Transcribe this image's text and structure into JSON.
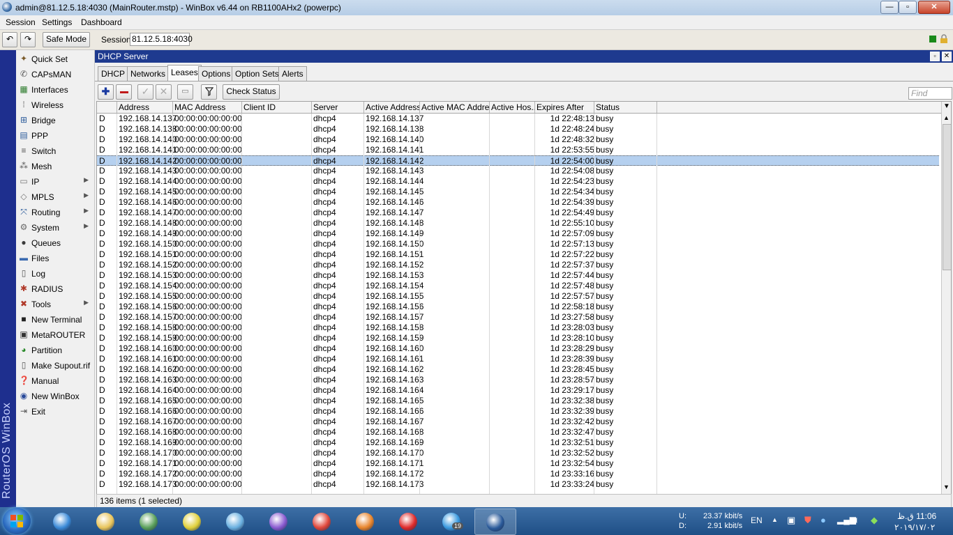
{
  "window": {
    "title": "admin@81.12.5.18:4030 (MainRouter.mstp) - WinBox v6.44 on RB1100AHx2 (powerpc)",
    "min": "—",
    "max": "▫",
    "close": "✕"
  },
  "menu": {
    "session": "Session",
    "settings": "Settings",
    "dashboard": "Dashboard"
  },
  "toolbar": {
    "undo": "↶",
    "redo": "↷",
    "safe_mode": "Safe Mode",
    "session_label": "Session:",
    "session_value": "81.12.5.18:4030"
  },
  "vbar_text": "RouterOS WinBox",
  "sidebar": [
    {
      "label": "Quick Set",
      "icon": "quick-set-icon",
      "glyph": "✦",
      "color": "#7a5a2a",
      "arrow": false
    },
    {
      "label": "CAPsMAN",
      "icon": "capsman-icon",
      "glyph": "✆",
      "color": "#555",
      "arrow": false
    },
    {
      "label": "Interfaces",
      "icon": "interfaces-icon",
      "glyph": "▦",
      "color": "#2a7a2a",
      "arrow": false
    },
    {
      "label": "Wireless",
      "icon": "wireless-icon",
      "glyph": "⁞",
      "color": "#555",
      "arrow": false
    },
    {
      "label": "Bridge",
      "icon": "bridge-icon",
      "glyph": "⊞",
      "color": "#2a5a9a",
      "arrow": false
    },
    {
      "label": "PPP",
      "icon": "ppp-icon",
      "glyph": "▤",
      "color": "#2a5a9a",
      "arrow": false
    },
    {
      "label": "Switch",
      "icon": "switch-icon",
      "glyph": "≡",
      "color": "#555",
      "arrow": false
    },
    {
      "label": "Mesh",
      "icon": "mesh-icon",
      "glyph": "⁂",
      "color": "#555",
      "arrow": false
    },
    {
      "label": "IP",
      "icon": "ip-icon",
      "glyph": "▭",
      "color": "#777",
      "arrow": true
    },
    {
      "label": "MPLS",
      "icon": "mpls-icon",
      "glyph": "◇",
      "color": "#777",
      "arrow": true
    },
    {
      "label": "Routing",
      "icon": "routing-icon",
      "glyph": "⤧",
      "color": "#2a5a9a",
      "arrow": true
    },
    {
      "label": "System",
      "icon": "system-icon",
      "glyph": "⚙",
      "color": "#666",
      "arrow": true
    },
    {
      "label": "Queues",
      "icon": "queues-icon",
      "glyph": "●",
      "color": "#3a3a3a",
      "arrow": false
    },
    {
      "label": "Files",
      "icon": "files-icon",
      "glyph": "▬",
      "color": "#3a6ab0",
      "arrow": false
    },
    {
      "label": "Log",
      "icon": "log-icon",
      "glyph": "▯",
      "color": "#555",
      "arrow": false
    },
    {
      "label": "RADIUS",
      "icon": "radius-icon",
      "glyph": "✱",
      "color": "#b03a2a",
      "arrow": false
    },
    {
      "label": "Tools",
      "icon": "tools-icon",
      "glyph": "✖",
      "color": "#b03a2a",
      "arrow": true
    },
    {
      "label": "New Terminal",
      "icon": "terminal-icon",
      "glyph": "■",
      "color": "#222",
      "arrow": false
    },
    {
      "label": "MetaROUTER",
      "icon": "metarouter-icon",
      "glyph": "▣",
      "color": "#333",
      "arrow": false
    },
    {
      "label": "Partition",
      "icon": "partition-icon",
      "glyph": "◕",
      "color": "#2a8a2a",
      "arrow": false
    },
    {
      "label": "Make Supout.rif",
      "icon": "supout-icon",
      "glyph": "▯",
      "color": "#555",
      "arrow": false
    },
    {
      "label": "Manual",
      "icon": "manual-icon",
      "glyph": "❓",
      "color": "#2a4a9a",
      "arrow": false
    },
    {
      "label": "New WinBox",
      "icon": "new-winbox-icon",
      "glyph": "◉",
      "color": "#2a4a9a",
      "arrow": false
    },
    {
      "label": "Exit",
      "icon": "exit-icon",
      "glyph": "⇥",
      "color": "#555",
      "arrow": false
    }
  ],
  "dhcp": {
    "title": "DHCP Server",
    "tabs": [
      "DHCP",
      "Networks",
      "Leases",
      "Options",
      "Option Sets",
      "Alerts"
    ],
    "active_tab": 2,
    "check_status": "Check Status",
    "find_placeholder": "Find",
    "columns": [
      "",
      "Address",
      "MAC Address",
      "Client ID",
      "Server",
      "Active Address",
      "Active MAC Addre...",
      "Active Hos...",
      "Expires After",
      "Status"
    ],
    "rows": [
      {
        "flag": "D",
        "address": "192.168.14.137",
        "mac": "00:00:00:00:00:00",
        "server": "dhcp4",
        "active_address": "192.168.14.137",
        "expires": "1d 22:48:13",
        "status": "busy"
      },
      {
        "flag": "D",
        "address": "192.168.14.138",
        "mac": "00:00:00:00:00:00",
        "server": "dhcp4",
        "active_address": "192.168.14.138",
        "expires": "1d 22:48:24",
        "status": "busy"
      },
      {
        "flag": "D",
        "address": "192.168.14.140",
        "mac": "00:00:00:00:00:00",
        "server": "dhcp4",
        "active_address": "192.168.14.140",
        "expires": "1d 22:48:32",
        "status": "busy"
      },
      {
        "flag": "D",
        "address": "192.168.14.141",
        "mac": "00:00:00:00:00:00",
        "server": "dhcp4",
        "active_address": "192.168.14.141",
        "expires": "1d 22:53:55",
        "status": "busy"
      },
      {
        "flag": "D",
        "address": "192.168.14.142",
        "mac": "00:00:00:00:00:00",
        "server": "dhcp4",
        "active_address": "192.168.14.142",
        "expires": "1d 22:54:00",
        "status": "busy",
        "selected": true
      },
      {
        "flag": "D",
        "address": "192.168.14.143",
        "mac": "00:00:00:00:00:00",
        "server": "dhcp4",
        "active_address": "192.168.14.143",
        "expires": "1d 22:54:08",
        "status": "busy"
      },
      {
        "flag": "D",
        "address": "192.168.14.144",
        "mac": "00:00:00:00:00:00",
        "server": "dhcp4",
        "active_address": "192.168.14.144",
        "expires": "1d 22:54:23",
        "status": "busy"
      },
      {
        "flag": "D",
        "address": "192.168.14.145",
        "mac": "00:00:00:00:00:00",
        "server": "dhcp4",
        "active_address": "192.168.14.145",
        "expires": "1d 22:54:34",
        "status": "busy"
      },
      {
        "flag": "D",
        "address": "192.168.14.146",
        "mac": "00:00:00:00:00:00",
        "server": "dhcp4",
        "active_address": "192.168.14.146",
        "expires": "1d 22:54:39",
        "status": "busy"
      },
      {
        "flag": "D",
        "address": "192.168.14.147",
        "mac": "00:00:00:00:00:00",
        "server": "dhcp4",
        "active_address": "192.168.14.147",
        "expires": "1d 22:54:49",
        "status": "busy"
      },
      {
        "flag": "D",
        "address": "192.168.14.148",
        "mac": "00:00:00:00:00:00",
        "server": "dhcp4",
        "active_address": "192.168.14.148",
        "expires": "1d 22:55:10",
        "status": "busy"
      },
      {
        "flag": "D",
        "address": "192.168.14.149",
        "mac": "00:00:00:00:00:00",
        "server": "dhcp4",
        "active_address": "192.168.14.149",
        "expires": "1d 22:57:09",
        "status": "busy"
      },
      {
        "flag": "D",
        "address": "192.168.14.150",
        "mac": "00:00:00:00:00:00",
        "server": "dhcp4",
        "active_address": "192.168.14.150",
        "expires": "1d 22:57:13",
        "status": "busy"
      },
      {
        "flag": "D",
        "address": "192.168.14.151",
        "mac": "00:00:00:00:00:00",
        "server": "dhcp4",
        "active_address": "192.168.14.151",
        "expires": "1d 22:57:22",
        "status": "busy"
      },
      {
        "flag": "D",
        "address": "192.168.14.152",
        "mac": "00:00:00:00:00:00",
        "server": "dhcp4",
        "active_address": "192.168.14.152",
        "expires": "1d 22:57:37",
        "status": "busy"
      },
      {
        "flag": "D",
        "address": "192.168.14.153",
        "mac": "00:00:00:00:00:00",
        "server": "dhcp4",
        "active_address": "192.168.14.153",
        "expires": "1d 22:57:44",
        "status": "busy"
      },
      {
        "flag": "D",
        "address": "192.168.14.154",
        "mac": "00:00:00:00:00:00",
        "server": "dhcp4",
        "active_address": "192.168.14.154",
        "expires": "1d 22:57:48",
        "status": "busy"
      },
      {
        "flag": "D",
        "address": "192.168.14.155",
        "mac": "00:00:00:00:00:00",
        "server": "dhcp4",
        "active_address": "192.168.14.155",
        "expires": "1d 22:57:57",
        "status": "busy"
      },
      {
        "flag": "D",
        "address": "192.168.14.156",
        "mac": "00:00:00:00:00:00",
        "server": "dhcp4",
        "active_address": "192.168.14.156",
        "expires": "1d 22:58:18",
        "status": "busy"
      },
      {
        "flag": "D",
        "address": "192.168.14.157",
        "mac": "00:00:00:00:00:00",
        "server": "dhcp4",
        "active_address": "192.168.14.157",
        "expires": "1d 23:27:58",
        "status": "busy"
      },
      {
        "flag": "D",
        "address": "192.168.14.158",
        "mac": "00:00:00:00:00:00",
        "server": "dhcp4",
        "active_address": "192.168.14.158",
        "expires": "1d 23:28:03",
        "status": "busy"
      },
      {
        "flag": "D",
        "address": "192.168.14.159",
        "mac": "00:00:00:00:00:00",
        "server": "dhcp4",
        "active_address": "192.168.14.159",
        "expires": "1d 23:28:10",
        "status": "busy"
      },
      {
        "flag": "D",
        "address": "192.168.14.160",
        "mac": "00:00:00:00:00:00",
        "server": "dhcp4",
        "active_address": "192.168.14.160",
        "expires": "1d 23:28:29",
        "status": "busy"
      },
      {
        "flag": "D",
        "address": "192.168.14.161",
        "mac": "00:00:00:00:00:00",
        "server": "dhcp4",
        "active_address": "192.168.14.161",
        "expires": "1d 23:28:39",
        "status": "busy"
      },
      {
        "flag": "D",
        "address": "192.168.14.162",
        "mac": "00:00:00:00:00:00",
        "server": "dhcp4",
        "active_address": "192.168.14.162",
        "expires": "1d 23:28:45",
        "status": "busy"
      },
      {
        "flag": "D",
        "address": "192.168.14.163",
        "mac": "00:00:00:00:00:00",
        "server": "dhcp4",
        "active_address": "192.168.14.163",
        "expires": "1d 23:28:57",
        "status": "busy"
      },
      {
        "flag": "D",
        "address": "192.168.14.164",
        "mac": "00:00:00:00:00:00",
        "server": "dhcp4",
        "active_address": "192.168.14.164",
        "expires": "1d 23:29:17",
        "status": "busy"
      },
      {
        "flag": "D",
        "address": "192.168.14.165",
        "mac": "00:00:00:00:00:00",
        "server": "dhcp4",
        "active_address": "192.168.14.165",
        "expires": "1d 23:32:38",
        "status": "busy"
      },
      {
        "flag": "D",
        "address": "192.168.14.166",
        "mac": "00:00:00:00:00:00",
        "server": "dhcp4",
        "active_address": "192.168.14.166",
        "expires": "1d 23:32:39",
        "status": "busy"
      },
      {
        "flag": "D",
        "address": "192.168.14.167",
        "mac": "00:00:00:00:00:00",
        "server": "dhcp4",
        "active_address": "192.168.14.167",
        "expires": "1d 23:32:42",
        "status": "busy"
      },
      {
        "flag": "D",
        "address": "192.168.14.168",
        "mac": "00:00:00:00:00:00",
        "server": "dhcp4",
        "active_address": "192.168.14.168",
        "expires": "1d 23:32:47",
        "status": "busy"
      },
      {
        "flag": "D",
        "address": "192.168.14.169",
        "mac": "00:00:00:00:00:00",
        "server": "dhcp4",
        "active_address": "192.168.14.169",
        "expires": "1d 23:32:51",
        "status": "busy"
      },
      {
        "flag": "D",
        "address": "192.168.14.170",
        "mac": "00:00:00:00:00:00",
        "server": "dhcp4",
        "active_address": "192.168.14.170",
        "expires": "1d 23:32:52",
        "status": "busy"
      },
      {
        "flag": "D",
        "address": "192.168.14.171",
        "mac": "00:00:00:00:00:00",
        "server": "dhcp4",
        "active_address": "192.168.14.171",
        "expires": "1d 23:32:54",
        "status": "busy"
      },
      {
        "flag": "D",
        "address": "192.168.14.172",
        "mac": "00:00:00:00:00:00",
        "server": "dhcp4",
        "active_address": "192.168.14.172",
        "expires": "1d 23:33:16",
        "status": "busy"
      },
      {
        "flag": "D",
        "address": "192.168.14.173",
        "mac": "00:00:00:00:00:00",
        "server": "dhcp4",
        "active_address": "192.168.14.173",
        "expires": "1d 23:33:24",
        "status": "busy"
      }
    ],
    "status_text": "136 items (1 selected)"
  },
  "taskbar": {
    "apps": [
      {
        "name": "internet-explorer",
        "color": "#3a8ad8",
        "active": false
      },
      {
        "name": "file-explorer",
        "color": "#e8c45a",
        "active": false
      },
      {
        "name": "network-globe",
        "color": "#5aa05a",
        "active": false
      },
      {
        "name": "hs-app",
        "color": "#e0d03a",
        "active": false
      },
      {
        "name": "cute-ftp",
        "color": "#6ab0e0",
        "active": false
      },
      {
        "name": "visual-studio",
        "color": "#8a5ad0",
        "active": false
      },
      {
        "name": "chrome",
        "color": "#e0463a",
        "active": false
      },
      {
        "name": "firefox",
        "color": "#e8842a",
        "active": false
      },
      {
        "name": "anydesk",
        "color": "#e02a2a",
        "active": false
      },
      {
        "name": "telegram",
        "color": "#3a9ae0",
        "active": false
      },
      {
        "name": "winbox",
        "color": "#2a5a9a",
        "active": true
      }
    ],
    "telegram_badge": "19",
    "upload_label": "U:",
    "download_label": "D:",
    "upload_rate": "23.37 kbit/s",
    "download_rate": "2.91 kbit/s",
    "language": "EN",
    "time": "11:06 ق.ظ",
    "date": "۲۰۱۹/۱۷/۰۲"
  }
}
